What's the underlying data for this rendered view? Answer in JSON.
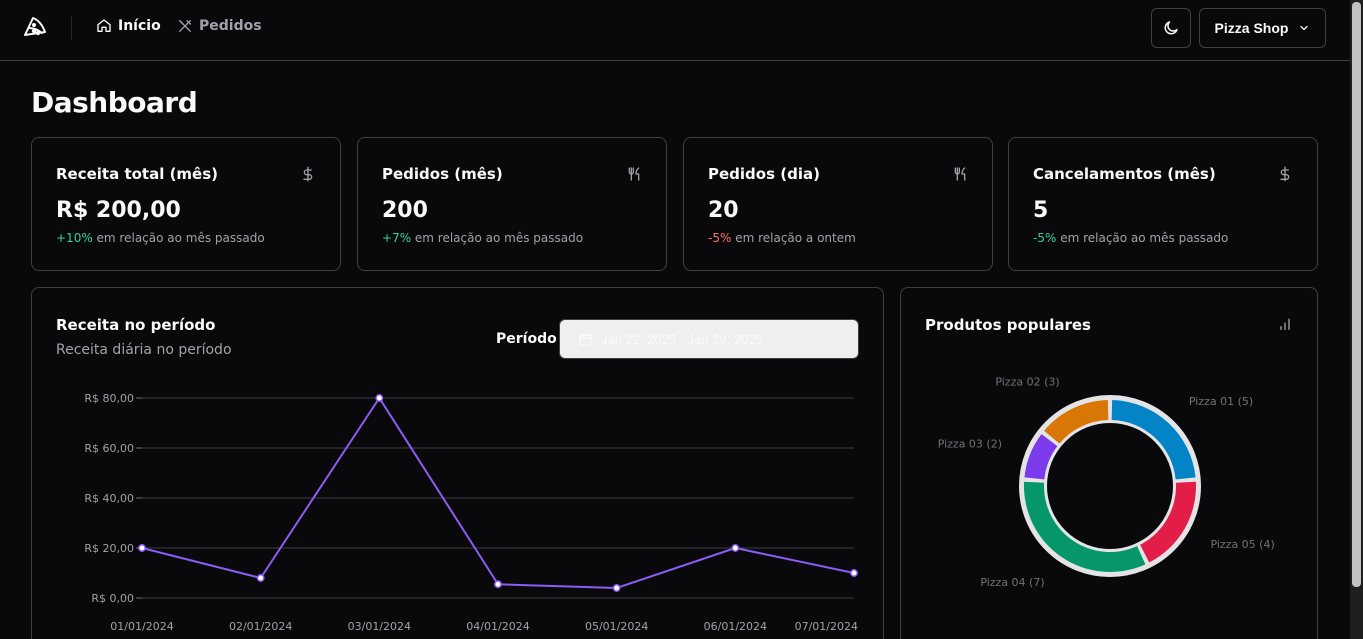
{
  "header": {
    "nav": [
      {
        "label": "Início",
        "icon": "home-icon",
        "active": true
      },
      {
        "label": "Pedidos",
        "icon": "utensils-crossed-icon",
        "active": false
      }
    ],
    "theme_icon": "moon-icon",
    "shop_label": "Pizza Shop"
  },
  "page_title": "Dashboard",
  "metrics": [
    {
      "title": "Receita total (mês)",
      "icon": "dollar-icon",
      "value": "R$ 200,00",
      "change": "+10%",
      "change_positive": true,
      "suffix": " em relação ao mês passado"
    },
    {
      "title": "Pedidos (mês)",
      "icon": "utensils-icon",
      "value": "200",
      "change": "+7%",
      "change_positive": true,
      "suffix": " em relação ao mês passado"
    },
    {
      "title": "Pedidos (dia)",
      "icon": "utensils-icon",
      "value": "20",
      "change": "-5%",
      "change_positive": false,
      "suffix": " em relação a ontem"
    },
    {
      "title": "Cancelamentos (mês)",
      "icon": "dollar-icon",
      "value": "5",
      "change": "-5%",
      "change_positive": true,
      "suffix": " em relação ao mês passado"
    }
  ],
  "revenue": {
    "title": "Receita no período",
    "subtitle": "Receita diária no período",
    "period_label": "Período",
    "date_range": "Jan 22, 2025 - Jan 29, 2025"
  },
  "popular": {
    "title": "Produtos populares"
  },
  "colors": {
    "line": "#8b5cf6",
    "pie": [
      "#0284c7",
      "#e11d48",
      "#059669",
      "#7c3aed",
      "#d97706"
    ]
  },
  "chart_data": [
    {
      "type": "line",
      "title": "",
      "x": [
        "01/01/2024",
        "02/01/2024",
        "03/01/2024",
        "04/01/2024",
        "05/01/2024",
        "06/01/2024",
        "07/01/2024"
      ],
      "series": [
        {
          "values": [
            20,
            8,
            80,
            5.5,
            4,
            20,
            10
          ]
        }
      ],
      "ylim": [
        0,
        80
      ],
      "yticks": [
        "R$ 0,00",
        "R$ 20,00",
        "R$ 40,00",
        "R$ 60,00",
        "R$ 80,00"
      ],
      "grid": true
    },
    {
      "type": "pie",
      "title": "",
      "categories": [
        "Pizza 01",
        "Pizza 05",
        "Pizza 04",
        "Pizza 03",
        "Pizza 02"
      ],
      "values": [
        5,
        4,
        7,
        2,
        3
      ],
      "labels": [
        "Pizza 01 (5)",
        "Pizza 05 (4)",
        "Pizza 04 (7)",
        "Pizza 03 (2)",
        "Pizza 02 (3)"
      ]
    }
  ]
}
